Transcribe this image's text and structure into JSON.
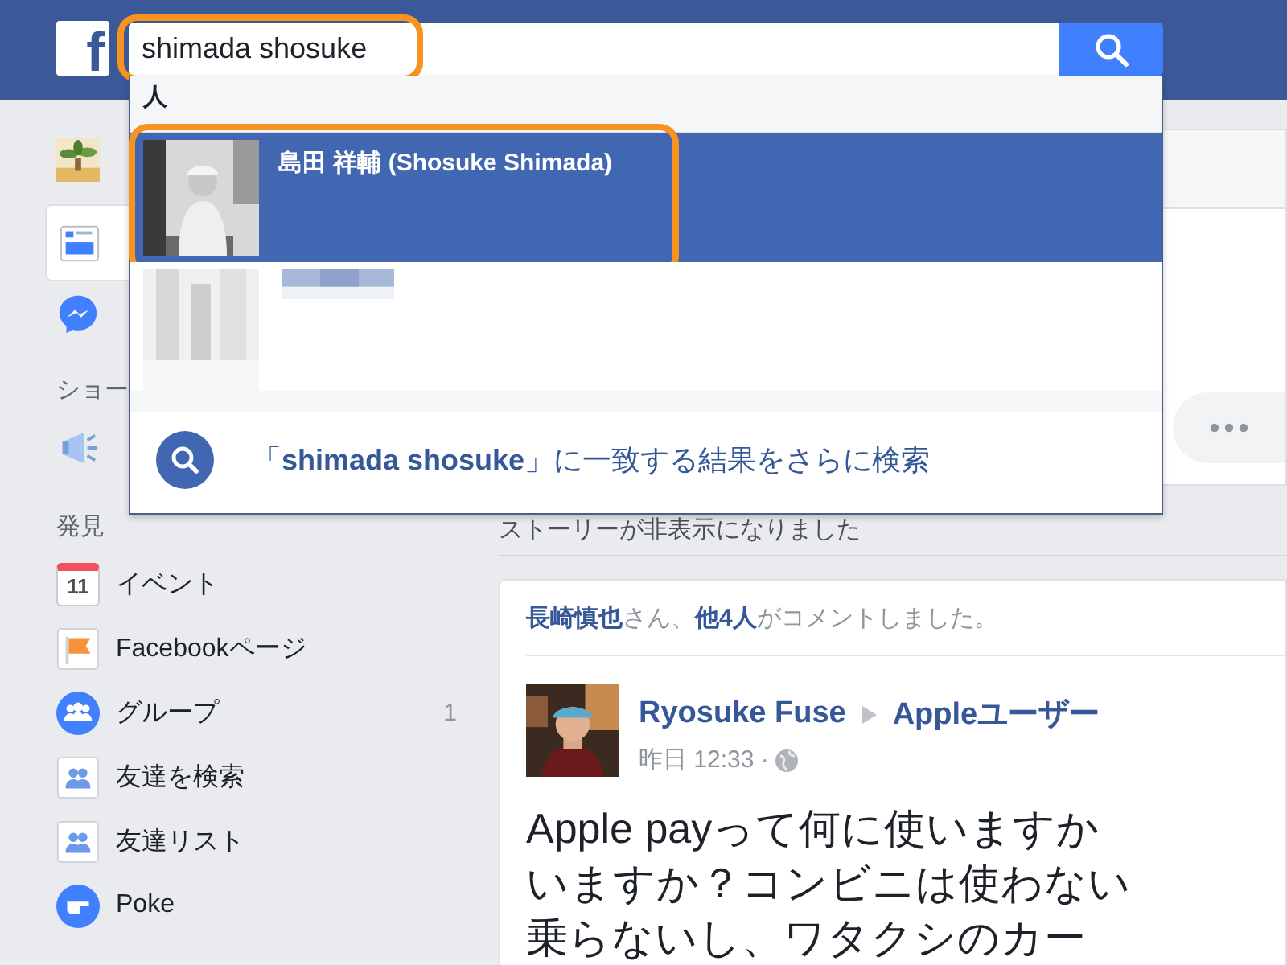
{
  "topbar": {
    "logo": "f",
    "search": {
      "value": "shimada shosuke",
      "highlighted": true
    }
  },
  "sidebar": {
    "sections": [
      {
        "items": [
          {
            "kind": "avatar",
            "selected": false
          },
          {
            "kind": "newsfeed",
            "selected": true
          },
          {
            "kind": "messenger",
            "selected": false
          }
        ]
      },
      {
        "header": "ショー",
        "items": [
          {
            "kind": "megaphone",
            "selected": false
          }
        ]
      },
      {
        "header": "発見",
        "items": [
          {
            "kind": "calendar",
            "label": "イベント",
            "icon_text": "11",
            "selected": false
          },
          {
            "kind": "flag",
            "label": "Facebookページ",
            "selected": false
          },
          {
            "kind": "group",
            "label": "グループ",
            "count": "1",
            "selected": false
          },
          {
            "kind": "friends",
            "label": "友達を検索",
            "selected": false
          },
          {
            "kind": "friends",
            "label": "友達リスト",
            "selected": false
          },
          {
            "kind": "poke",
            "label": "Poke",
            "selected": false
          }
        ]
      }
    ]
  },
  "search_dropdown": {
    "section": "人",
    "results": [
      {
        "kind": "person",
        "name": "島田 祥輔 (Shosuke Shimada)",
        "selected": true,
        "highlighted": true
      },
      {
        "kind": "blurred",
        "selected": false
      }
    ],
    "more": "「**shimada shosuke**」に一致する結果をさらに検索"
  },
  "main": {
    "notice": "ストーリーが非表示になりました",
    "post": {
      "activity": "**長崎慎也**さん、**他4人**がコメントしました。",
      "author": "Ryosuke Fuse",
      "group": "Appleユーザー",
      "time": "昨日 12:33 ·",
      "lines": [
        "Apple payって何に使いますか",
        "いますか？コンビニは使わない",
        "乗らないし、ワタクシのカー"
      ]
    }
  }
}
